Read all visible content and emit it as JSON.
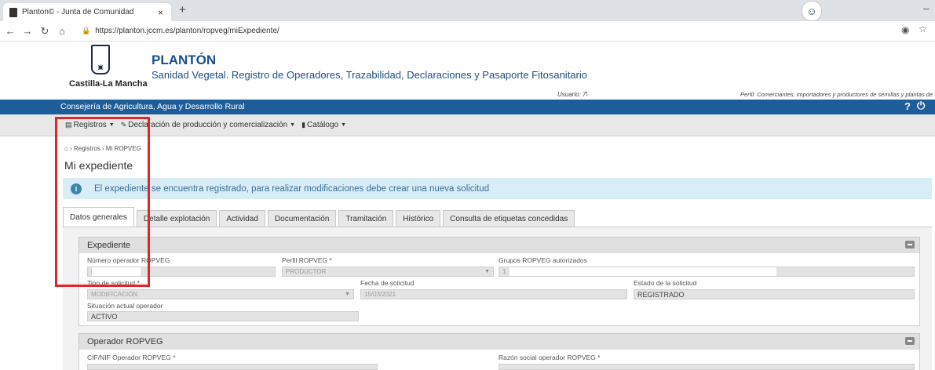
{
  "browser": {
    "tab_title": "Planton© - Junta de Comunidad",
    "tab_close": "×",
    "new_tab": "+",
    "url": "https://planton.jccm.es/planton/ropveg/miExpediente/"
  },
  "header": {
    "logo_caption": "Castilla-La Mancha",
    "app_title": "PLANTÓN",
    "app_subtitle": "Sanidad Vegetal. Registro de Operadores, Trazabilidad, Declaraciones y Pasaporte Fitosanitario",
    "user_label": "Usuario: 7\\",
    "perfil_label": "Perfil: Comerciantes, importadores y productores de semillas y plantas de vivero"
  },
  "bluebar": {
    "department": "Consejería de Agricultura, Agua y Desarrollo Rural",
    "help": "?",
    "power": "⏻"
  },
  "menu": {
    "items": [
      {
        "label": "Registros"
      },
      {
        "label": "Declaración de producción y comercialización"
      },
      {
        "label": "Catálogo"
      }
    ]
  },
  "breadcrumb": {
    "home": "⌂",
    "sep": "›",
    "items": [
      "Registros",
      "Mi ROPVEG"
    ]
  },
  "page": {
    "title": "Mi expediente",
    "info_message": "El expediente se encuentra registrado, para realizar modificaciones debe crear una nueva solicitud"
  },
  "tabs": [
    {
      "label": "Datos generales"
    },
    {
      "label": "Detalle explotación"
    },
    {
      "label": "Actividad"
    },
    {
      "label": "Documentación"
    },
    {
      "label": "Tramitación"
    },
    {
      "label": "Histórico"
    },
    {
      "label": "Consulta de etiquetas concedidas"
    }
  ],
  "expediente": {
    "title": "Expediente",
    "numero_label": "Número operador ROPVEG",
    "numero_value": "E",
    "perfil_label": "Perfil ROPVEG *",
    "perfil_value": "PRODUCTOR",
    "grupos_label": "Grupos ROPVEG autorizados",
    "grupos_value": "1.",
    "tipo_label": "Tipo de solicitud *",
    "tipo_value": "MODIFICACIÓN",
    "fecha_label": "Fecha de solicitud",
    "fecha_value": "15/03/2021",
    "estado_label": "Estado de la solicitud",
    "estado_value": "REGISTRADO",
    "situacion_label": "Situación actual operador",
    "situacion_value": "ACTIVO"
  },
  "operador": {
    "title": "Operador ROPVEG",
    "cif_label": "CIF/NIF Operador ROPVEG *",
    "razon_label": "Razón social operador ROPVEG *"
  },
  "colors": {
    "brand_blue": "#1d5e9a",
    "title_blue": "#1a4f8b",
    "info_bg": "#d9edf7",
    "highlight_red": "#e0262b"
  }
}
